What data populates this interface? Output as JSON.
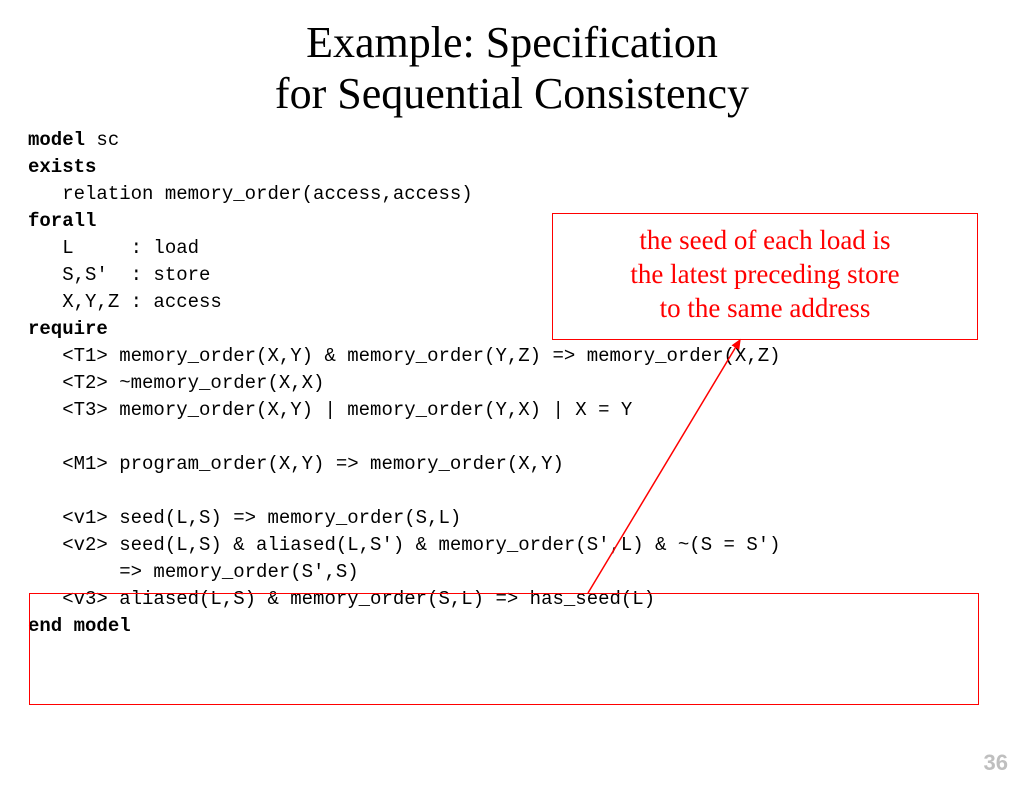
{
  "title_line1": "Example: Specification",
  "title_line2": "for Sequential Consistency",
  "callout_line1": "the seed of each load is",
  "callout_line2": "the latest preceding store",
  "callout_line3": "to the same address",
  "page_number": "36",
  "code": {
    "l01a": "model",
    "l01b": " sc",
    "l02": "exists",
    "l03": "   relation memory_order(access,access)",
    "l04": "forall",
    "l05": "   L     : load",
    "l06": "   S,S'  : store",
    "l07": "   X,Y,Z : access",
    "l08": "require",
    "l09": "   <T1> memory_order(X,Y) & memory_order(Y,Z) => memory_order(X,Z)",
    "l10": "   <T2> ~memory_order(X,X)",
    "l11": "   <T3> memory_order(X,Y) | memory_order(Y,X) | X = Y",
    "l12": "",
    "l13": "   <M1> program_order(X,Y) => memory_order(X,Y)",
    "l14": "",
    "l15": "   <v1> seed(L,S) => memory_order(S,L)",
    "l16": "   <v2> seed(L,S) & aliased(L,S') & memory_order(S',L) & ~(S = S')",
    "l17": "        => memory_order(S',S)",
    "l18": "   <v3> aliased(L,S) & memory_order(S,L) => has_seed(L)",
    "l19": "end model"
  }
}
